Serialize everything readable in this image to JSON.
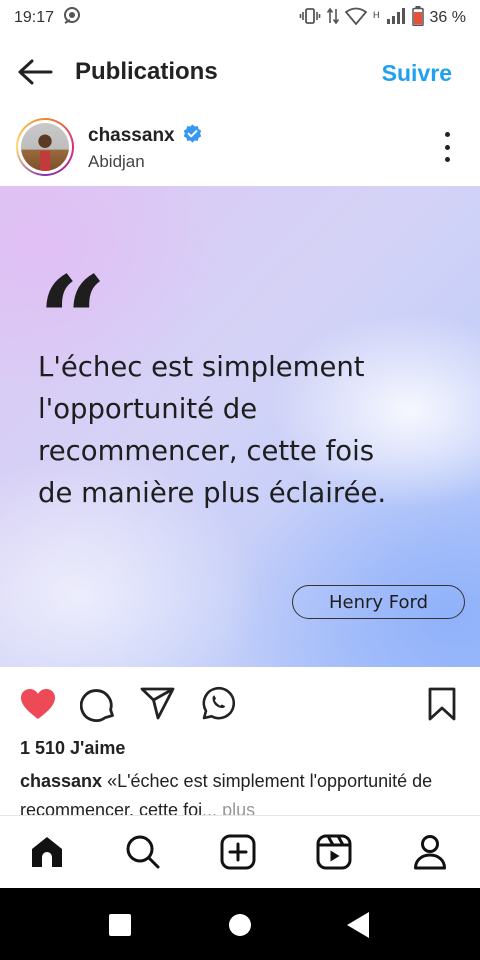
{
  "status_bar": {
    "time": "19:17",
    "network_label": "H",
    "battery_percent": "36 %",
    "icons": [
      "notification-icon",
      "vibrate-icon",
      "data-transfer-icon",
      "wifi-icon",
      "signal-icon",
      "battery-icon"
    ]
  },
  "header": {
    "title": "Publications",
    "follow_label": "Suivre",
    "back_icon": "arrow-left-icon"
  },
  "profile": {
    "username": "chassanx",
    "location": "Abidjan",
    "verified": true
  },
  "post": {
    "quote_mark": "“",
    "quote_lines": [
      "L'échec est simplement",
      "l'opportunité de",
      "recommencer, cette fois",
      "de manière plus éclairée."
    ],
    "author": "Henry Ford"
  },
  "actions": {
    "liked": true,
    "icons": [
      "heart-icon",
      "comment-icon",
      "share-icon",
      "whatsapp-icon",
      "bookmark-icon"
    ]
  },
  "likes_text": "1 510 J'aime",
  "caption": {
    "username": "chassanx",
    "text": " «L'échec est simplement l'opportunité de recommencer, cette foi",
    "more": "... plus"
  },
  "bottom_nav": [
    "home-icon",
    "search-icon",
    "create-icon",
    "reels-icon",
    "profile-icon"
  ],
  "colors": {
    "accent": "#1ea1f1",
    "like": "#ed4956"
  }
}
